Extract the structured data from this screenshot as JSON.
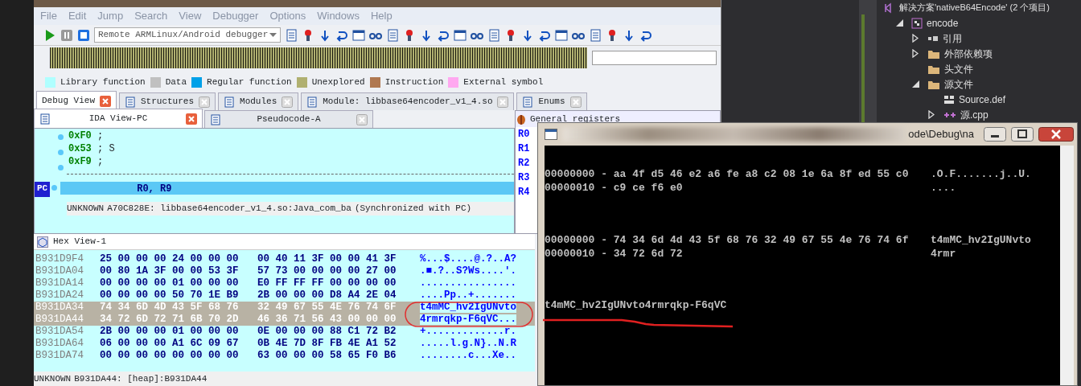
{
  "ida": {
    "menu": [
      "File",
      "Edit",
      "Jump",
      "Search",
      "View",
      "Debugger",
      "Options",
      "Windows",
      "Help"
    ],
    "debugger_select": {
      "value": "Remote ARMLinux/Android debugger"
    },
    "legend": [
      {
        "label": "Library function",
        "color": "#b0ffff"
      },
      {
        "label": "Data",
        "color": "#c0c0c0"
      },
      {
        "label": "Regular function",
        "color": "#00a0e8"
      },
      {
        "label": "Unexplored",
        "color": "#b0b070"
      },
      {
        "label": "Instruction",
        "color": "#b07850"
      },
      {
        "label": "External symbol",
        "color": "#ffa8f0"
      }
    ],
    "tabs": [
      {
        "label": "Debug View",
        "selected": true
      },
      {
        "label": "Structures",
        "selected": false
      },
      {
        "label": "Modules",
        "selected": false
      },
      {
        "label": "Module: libbase64encoder_v1_4.so",
        "selected": false
      },
      {
        "label": "Enums",
        "selected": false
      }
    ],
    "subtabs": [
      {
        "label": "IDA View-PC",
        "selected": true
      },
      {
        "label": "Pseudocode-A",
        "selected": false
      }
    ],
    "disasm": {
      "lines": [
        {
          "value": "0xF0",
          "comment": ";"
        },
        {
          "value": "0x53",
          "comment": "; S"
        },
        {
          "value": "0xF9",
          "comment": ";"
        }
      ],
      "pc_marker": "PC",
      "pc_line": "R0, R9",
      "status": [
        "UNKNOWN",
        "A70C828E: libbase64encoder_v1_4.so:Java_com_ba",
        "(Synchronized with PC)"
      ]
    },
    "registers": {
      "title": "General registers",
      "names": [
        "R0",
        "R1",
        "R2",
        "R3",
        "R4"
      ]
    },
    "hex_view": {
      "title": "Hex View-1",
      "rows": [
        {
          "address": "B931D9F4",
          "bytes1": "25 00 00 00 24 00 00 00",
          "bytes2": "00 40 11 3F 00 00 41 3F",
          "ascii": "%...$....@.?..A?",
          "selected": false
        },
        {
          "address": "B931DA04",
          "bytes1": "00 80 1A 3F 00 00 53 3F",
          "bytes2": "57 73 00 00 00 00 27 00",
          "ascii": ".■.?..S?Ws....'.",
          "selected": false
        },
        {
          "address": "B931DA14",
          "bytes1": "00 00 00 00 01 00 00 00",
          "bytes2": "E0 FF FF FF 00 00 00 00",
          "ascii": "................",
          "selected": false
        },
        {
          "address": "B931DA24",
          "bytes1": "00 00 00 00 50 70 1E B9",
          "bytes2": "2B 00 00 00 D8 A4 2E 04",
          "ascii": "....Pp..+.......",
          "selected": false
        },
        {
          "address": "B931DA34",
          "bytes1": "74 34 6D 4D 43 5F 68 76",
          "bytes2": "32 49 67 55 4E 76 74 6F",
          "ascii": "t4mMC_hv2IgUNvto",
          "selected": true
        },
        {
          "address": "B931DA44",
          "bytes1": "34 72 6D 72 71 6B 70 2D",
          "bytes2": "46 36 71 56 43 00 00 00",
          "ascii": "4rmrqkp-F6qVC...",
          "selected": true
        },
        {
          "address": "B931DA54",
          "bytes1": "2B 00 00 00 01 00 00 00",
          "bytes2": "0E 00 00 00 88 C1 72 B2",
          "ascii": "+.............r.",
          "selected": false
        },
        {
          "address": "B931DA64",
          "bytes1": "06 00 00 00 A1 6C 09 67",
          "bytes2": "0B 4E 7D 8F FB 4E A1 52",
          "ascii": ".....l.g.N}..N.R",
          "selected": false
        },
        {
          "address": "B931DA74",
          "bytes1": "00 00 00 00 00 00 00 00",
          "bytes2": "63 00 00 00 58 65 F0 B6",
          "ascii": "........c...Xe..",
          "selected": false
        }
      ],
      "status": [
        "UNKNOWN",
        "B931DA44: [heap]:B931DA44"
      ]
    }
  },
  "console": {
    "title": "ode\\Debug\\na",
    "dumps": [
      [
        {
          "bytes": "00000000 - aa 4f d5 46 e2 a6 fe a8 c2 08 1e 6a 8f ed 55 c0",
          "ascii": ".O.F.......j..U."
        },
        {
          "bytes": "00000010 - c9 ce f6 e0",
          "ascii": "...."
        }
      ],
      [
        {
          "bytes": "00000000 - 74 34 6d 4d 43 5f 68 76 32 49 67 55 4e 76 74 6f",
          "ascii": "t4mMC_hv2IgUNvto"
        },
        {
          "bytes": "00000010 - 34 72 6d 72",
          "ascii": "4rmr"
        }
      ]
    ],
    "output": "t4mMC_hv2IgUNvto4rmrqkp-F6qVC"
  },
  "solution_explorer": {
    "items": [
      {
        "label": "解决方案'nativeB64Encode' (2 个项目)",
        "kind": "solution",
        "children": [
          {
            "label": "encode",
            "kind": "project",
            "expanded": true,
            "children": [
              {
                "label": "引用",
                "kind": "references",
                "expanded": false
              },
              {
                "label": "外部依赖项",
                "kind": "folder",
                "expanded": false
              },
              {
                "label": "头文件",
                "kind": "folder"
              },
              {
                "label": "源文件",
                "kind": "folder",
                "expanded": true,
                "children": [
                  {
                    "label": "Source.def",
                    "kind": "def"
                  },
                  {
                    "label": "源.cpp",
                    "kind": "cpp",
                    "expanded": false
                  }
                ]
              }
            ]
          }
        ]
      }
    ]
  }
}
